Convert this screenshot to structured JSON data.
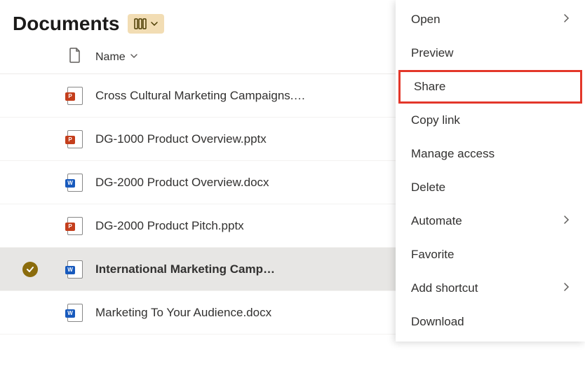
{
  "header": {
    "title": "Documents"
  },
  "columns": {
    "name": "Name"
  },
  "files": [
    {
      "name": "Cross Cultural Marketing Campaigns.pptx",
      "type": "pp",
      "selected": false
    },
    {
      "name": "DG-1000 Product Overview.pptx",
      "type": "pp",
      "selected": false
    },
    {
      "name": "DG-2000 Product Overview.docx",
      "type": "w",
      "selected": false
    },
    {
      "name": "DG-2000 Product Pitch.pptx",
      "type": "pp",
      "selected": false
    },
    {
      "name": "International Marketing Camp…",
      "type": "w",
      "selected": true
    },
    {
      "name": "Marketing To Your Audience.docx",
      "type": "w",
      "selected": false
    }
  ],
  "file_icon_letters": {
    "pp": "P",
    "w": "W"
  },
  "menu": {
    "items": [
      {
        "label": "Open",
        "submenu": true
      },
      {
        "label": "Preview",
        "submenu": false
      },
      {
        "label": "Share",
        "submenu": false,
        "highlighted": true
      },
      {
        "label": "Copy link",
        "submenu": false
      },
      {
        "label": "Manage access",
        "submenu": false
      },
      {
        "label": "Delete",
        "submenu": false
      },
      {
        "label": "Automate",
        "submenu": true
      },
      {
        "label": "Favorite",
        "submenu": false
      },
      {
        "label": "Add shortcut",
        "submenu": true
      },
      {
        "label": "Download",
        "submenu": false
      }
    ]
  }
}
